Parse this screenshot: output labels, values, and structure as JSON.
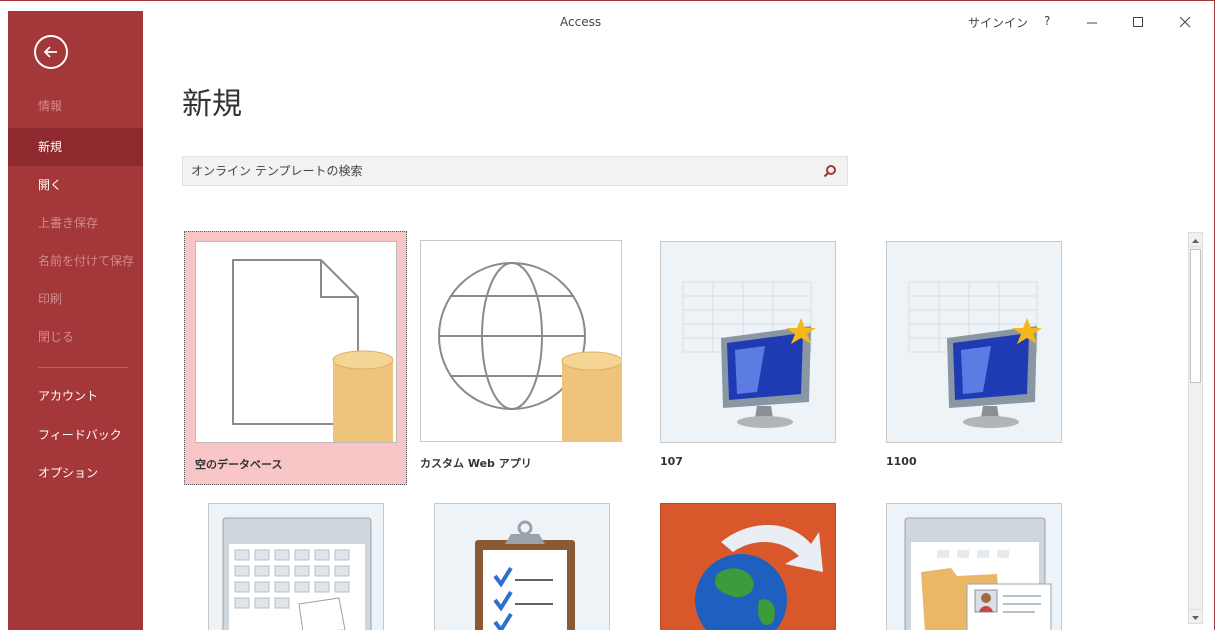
{
  "app_title": "Access",
  "titlebar": {
    "signin": "サインイン",
    "help": "?"
  },
  "page_title": "新規",
  "search": {
    "placeholder": "オンライン テンプレートの検索"
  },
  "backstage": {
    "accent_color": "#a4373a",
    "items": [
      {
        "label": "情報",
        "state": "disabled"
      },
      {
        "label": "新規",
        "state": "selected"
      },
      {
        "label": "開く",
        "state": "enabled"
      },
      {
        "label": "上書き保存",
        "state": "disabled"
      },
      {
        "label": "名前を付けて保存",
        "state": "disabled"
      },
      {
        "label": "印刷",
        "state": "disabled"
      },
      {
        "label": "閉じる",
        "state": "disabled"
      },
      {
        "label": "アカウント",
        "state": "enabled"
      },
      {
        "label": "フィードバック",
        "state": "enabled"
      },
      {
        "label": "オプション",
        "state": "enabled"
      }
    ]
  },
  "templates": [
    {
      "label": "空のデータベース",
      "icon": "blank-database-icon",
      "selected": true
    },
    {
      "label": "カスタム Web アプリ",
      "icon": "web-app-icon"
    },
    {
      "label": "107",
      "icon": "new-database-monitor-icon"
    },
    {
      "label": "1100",
      "icon": "new-database-monitor-icon"
    },
    {
      "label": "",
      "icon": "calendar-template-icon"
    },
    {
      "label": "",
      "icon": "task-clipboard-icon"
    },
    {
      "label": "",
      "icon": "globe-sync-icon"
    },
    {
      "label": "",
      "icon": "contacts-folder-icon"
    }
  ]
}
